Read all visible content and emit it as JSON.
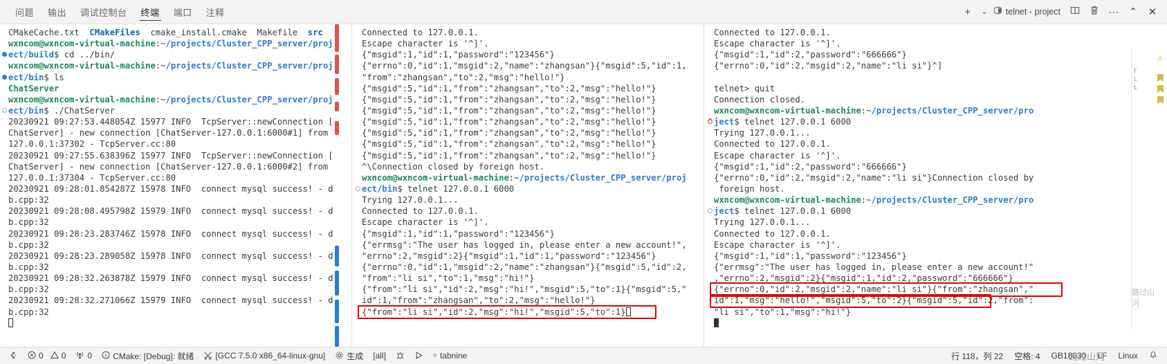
{
  "panel": {
    "tabs": [
      {
        "label": "问题",
        "active": false
      },
      {
        "label": "输出",
        "active": false
      },
      {
        "label": "调试控制台",
        "active": false
      },
      {
        "label": "终端",
        "active": true
      },
      {
        "label": "端口",
        "active": false
      },
      {
        "label": "注释",
        "active": false
      }
    ],
    "actions": {
      "add_label": "+",
      "add_dropdown": "⌄",
      "terminal_name": "telnet - project",
      "terminal_icon": "terminal-icon",
      "split_label": "▯▯",
      "kill_label": "🗑",
      "more_label": "···",
      "maximize_label": "⌃",
      "close_label": "✕"
    }
  },
  "terminal_1": {
    "lines": [
      {
        "deco": "",
        "segs": [
          {
            "t": "CMakeCache.txt  ",
            "c": "plain"
          },
          {
            "t": "CMakeFiles",
            "c": "blu"
          },
          {
            "t": "  cmake_install.cmake  Makefile  ",
            "c": "plain"
          },
          {
            "t": "src",
            "c": "blu"
          }
        ]
      },
      {
        "deco": "",
        "segs": [
          {
            "t": "wxncom@wxncom-virtual-machine",
            "c": "grn"
          },
          {
            "t": ":",
            "c": "plain"
          },
          {
            "t": "~/projects/Cluster_CPP_server/proj",
            "c": "blu-dir"
          }
        ]
      },
      {
        "deco": "filled",
        "segs": [
          {
            "t": "ect/build",
            "c": "blu-dir"
          },
          {
            "t": "$ cd ../bin/",
            "c": "plain"
          }
        ]
      },
      {
        "deco": "",
        "segs": [
          {
            "t": "wxncom@wxncom-virtual-machine",
            "c": "grn"
          },
          {
            "t": ":",
            "c": "plain"
          },
          {
            "t": "~/projects/Cluster_CPP_server/proj",
            "c": "blu-dir"
          }
        ]
      },
      {
        "deco": "filled",
        "segs": [
          {
            "t": "ect/bin",
            "c": "blu-dir"
          },
          {
            "t": "$ ls",
            "c": "plain"
          }
        ]
      },
      {
        "deco": "",
        "segs": [
          {
            "t": "ChatServer",
            "c": "grn"
          }
        ]
      },
      {
        "deco": "",
        "segs": [
          {
            "t": "wxncom@wxncom-virtual-machine",
            "c": "grn"
          },
          {
            "t": ":",
            "c": "plain"
          },
          {
            "t": "~/projects/Cluster_CPP_server/proj",
            "c": "blu-dir"
          }
        ]
      },
      {
        "deco": "hollow",
        "segs": [
          {
            "t": "ect/bin",
            "c": "blu-dir"
          },
          {
            "t": "$ ./ChatServer",
            "c": "plain"
          }
        ]
      },
      {
        "deco": "",
        "segs": [
          {
            "t": "20230921 09:27:53.448054Z 15977 INFO  TcpServer::newConnection [",
            "c": "plain"
          }
        ]
      },
      {
        "deco": "",
        "segs": [
          {
            "t": "ChatServer] - new connection [ChatServer-127.0.0.1:6000#1] from",
            "c": "plain"
          }
        ]
      },
      {
        "deco": "",
        "segs": [
          {
            "t": "127.0.0.1:37302 - TcpServer.cc:80",
            "c": "plain"
          }
        ]
      },
      {
        "deco": "",
        "segs": [
          {
            "t": "20230921 09:27:55.638396Z 15977 INFO  TcpServer::newConnection [",
            "c": "plain"
          }
        ]
      },
      {
        "deco": "",
        "segs": [
          {
            "t": "ChatServer] - new connection [ChatServer-127.0.0.1:6000#2] from",
            "c": "plain"
          }
        ]
      },
      {
        "deco": "",
        "segs": [
          {
            "t": "127.0.0.1:37304 - TcpServer.cc:80",
            "c": "plain"
          }
        ]
      },
      {
        "deco": "",
        "segs": [
          {
            "t": "20230921 09:28:01.854287Z 15978 INFO  connect mysql success! - d",
            "c": "plain"
          }
        ]
      },
      {
        "deco": "",
        "segs": [
          {
            "t": "b.cpp:32",
            "c": "plain"
          }
        ]
      },
      {
        "deco": "",
        "segs": [
          {
            "t": "20230921 09:28:08.495798Z 15979 INFO  connect mysql success! - d",
            "c": "plain"
          }
        ]
      },
      {
        "deco": "",
        "segs": [
          {
            "t": "b.cpp:32",
            "c": "plain"
          }
        ]
      },
      {
        "deco": "",
        "segs": [
          {
            "t": "20230921 09:28:23.283746Z 15978 INFO  connect mysql success! - d",
            "c": "plain"
          }
        ]
      },
      {
        "deco": "",
        "segs": [
          {
            "t": "b.cpp:32",
            "c": "plain"
          }
        ]
      },
      {
        "deco": "",
        "segs": [
          {
            "t": "20230921 09:28:23.289058Z 15978 INFO  connect mysql success! - d",
            "c": "plain"
          }
        ]
      },
      {
        "deco": "",
        "segs": [
          {
            "t": "b.cpp:32",
            "c": "plain"
          }
        ]
      },
      {
        "deco": "",
        "segs": [
          {
            "t": "20230921 09:28:32.263878Z 15979 INFO  connect mysql success! - d",
            "c": "plain"
          }
        ]
      },
      {
        "deco": "",
        "segs": [
          {
            "t": "b.cpp:32",
            "c": "plain"
          }
        ]
      },
      {
        "deco": "",
        "segs": [
          {
            "t": "20230921 09:28:32.271066Z 15979 INFO  connect mysql success! - d",
            "c": "plain"
          }
        ]
      },
      {
        "deco": "",
        "segs": [
          {
            "t": "b.cpp:32",
            "c": "plain"
          }
        ]
      },
      {
        "deco": "",
        "segs": [
          {
            "t": "",
            "c": "plain"
          }
        ],
        "cursor": "hollow"
      }
    ]
  },
  "terminal_2": {
    "lines": [
      {
        "deco": "",
        "segs": [
          {
            "t": "Connected to 127.0.0.1.",
            "c": "plain"
          }
        ]
      },
      {
        "deco": "",
        "segs": [
          {
            "t": "Escape character is '^]'.",
            "c": "plain"
          }
        ]
      },
      {
        "deco": "",
        "segs": [
          {
            "t": "{\"msgid\":1,\"id\":1,\"password\":\"123456\"}",
            "c": "plain"
          }
        ]
      },
      {
        "deco": "",
        "segs": [
          {
            "t": "{\"errno\":0,\"id\":1,\"msgid\":2,\"name\":\"zhangsan\"}{\"msgid\":5,\"id\":1,",
            "c": "plain"
          }
        ]
      },
      {
        "deco": "",
        "segs": [
          {
            "t": "\"from\":\"zhangsan\",\"to\":2,\"msg\":\"hello!\"}",
            "c": "plain"
          }
        ]
      },
      {
        "deco": "",
        "segs": [
          {
            "t": "{\"msgid\":5,\"id\":1,\"from\":\"zhangsan\",\"to\":2,\"msg\":\"hello!\"}",
            "c": "plain"
          }
        ]
      },
      {
        "deco": "",
        "segs": [
          {
            "t": "{\"msgid\":5,\"id\":1,\"from\":\"zhangsan\",\"to\":2,\"msg\":\"hello!\"}",
            "c": "plain"
          }
        ]
      },
      {
        "deco": "",
        "segs": [
          {
            "t": "{\"msgid\":5,\"id\":1,\"from\":\"zhangsan\",\"to\":2,\"msg\":\"hello!\"}",
            "c": "plain"
          }
        ]
      },
      {
        "deco": "",
        "segs": [
          {
            "t": "{\"msgid\":5,\"id\":1,\"from\":\"zhangsan\",\"to\":2,\"msg\":\"hello!\"}",
            "c": "plain"
          }
        ]
      },
      {
        "deco": "",
        "segs": [
          {
            "t": "{\"msgid\":5,\"id\":1,\"from\":\"zhangsan\",\"to\":2,\"msg\":\"hello!\"}",
            "c": "plain"
          }
        ]
      },
      {
        "deco": "",
        "segs": [
          {
            "t": "{\"msgid\":5,\"id\":1,\"from\":\"zhangsan\",\"to\":2,\"msg\":\"hello!\"}",
            "c": "plain"
          }
        ]
      },
      {
        "deco": "",
        "segs": [
          {
            "t": "{\"msgid\":5,\"id\":1,\"from\":\"zhangsan\",\"to\":2,\"msg\":\"hello!\"}",
            "c": "plain"
          }
        ]
      },
      {
        "deco": "",
        "segs": [
          {
            "t": "^\\Connection closed by foreign host.",
            "c": "plain"
          }
        ]
      },
      {
        "deco": "",
        "segs": [
          {
            "t": "wxncom@wxncom-virtual-machine",
            "c": "grn"
          },
          {
            "t": ":",
            "c": "plain"
          },
          {
            "t": "~/projects/Cluster_CPP_server/proj",
            "c": "blu-dir"
          }
        ]
      },
      {
        "deco": "hollow",
        "segs": [
          {
            "t": "ect/bin",
            "c": "blu-dir"
          },
          {
            "t": "$ telnet 127.0.0.1 6000",
            "c": "plain"
          }
        ]
      },
      {
        "deco": "",
        "segs": [
          {
            "t": "Trying 127.0.0.1...",
            "c": "plain"
          }
        ]
      },
      {
        "deco": "",
        "segs": [
          {
            "t": "Connected to 127.0.0.1.",
            "c": "plain"
          }
        ]
      },
      {
        "deco": "",
        "segs": [
          {
            "t": "Escape character is '^]'.",
            "c": "plain"
          }
        ]
      },
      {
        "deco": "",
        "segs": [
          {
            "t": "{\"msgid\":1,\"id\":1,\"password\":\"123456\"}",
            "c": "plain"
          }
        ]
      },
      {
        "deco": "",
        "segs": [
          {
            "t": "{\"errmsg\":\"The user has logged in, please enter a new account!\",",
            "c": "plain"
          }
        ]
      },
      {
        "deco": "",
        "segs": [
          {
            "t": "\"errno\":2,\"msgid\":2}{\"msgid\":1,\"id\":1,\"password\":\"123456\"}",
            "c": "plain"
          }
        ]
      },
      {
        "deco": "",
        "segs": [
          {
            "t": "{\"errno\":0,\"id\":1,\"msgid\":2,\"name\":\"zhangsan\"}{\"msgid\":5,\"id\":2,",
            "c": "plain"
          }
        ]
      },
      {
        "deco": "",
        "segs": [
          {
            "t": "\"from\":\"li si\",\"to\":1,\"msg\":\"hi!\"}",
            "c": "plain"
          }
        ]
      },
      {
        "deco": "",
        "segs": [
          {
            "t": "{\"from\":\"li si\",\"id\":2,\"msg\":\"hi!\",\"msgid\":5,\"to\":1}{\"msgid\":5,\"",
            "c": "plain"
          }
        ]
      },
      {
        "deco": "",
        "segs": [
          {
            "t": "id\":1,\"from\":\"zhangsan\",\"to\":2,\"msg\":\"hello!\"}",
            "c": "plain"
          }
        ]
      },
      {
        "deco": "",
        "segs": [
          {
            "t": "{\"from\":\"li si\",\"id\":2,\"msg\":\"hi!\",\"msgid\":5,\"to\":1}",
            "c": "plain"
          }
        ],
        "cursor": "hollow",
        "boxed": true
      }
    ]
  },
  "terminal_3": {
    "lines": [
      {
        "deco": "",
        "segs": [
          {
            "t": "Connected to 127.0.0.1.",
            "c": "plain"
          }
        ]
      },
      {
        "deco": "",
        "segs": [
          {
            "t": "Escape character is '^]'.",
            "c": "plain"
          }
        ]
      },
      {
        "deco": "",
        "segs": [
          {
            "t": "{\"msgid\":1,\"id\":2,\"password\":\"666666\"}",
            "c": "plain"
          }
        ]
      },
      {
        "deco": "",
        "segs": [
          {
            "t": "{\"errno\":0,\"id\":2,\"msgid\":2,\"name\":\"li si\"}^]",
            "c": "plain"
          }
        ]
      },
      {
        "deco": "",
        "segs": [
          {
            "t": "",
            "c": "plain"
          }
        ]
      },
      {
        "deco": "",
        "segs": [
          {
            "t": "telnet> quit",
            "c": "plain"
          }
        ]
      },
      {
        "deco": "",
        "segs": [
          {
            "t": "Connection closed.",
            "c": "plain"
          }
        ]
      },
      {
        "deco": "",
        "segs": [
          {
            "t": "wxncom@wxncom-virtual-machine",
            "c": "grn"
          },
          {
            "t": ":",
            "c": "plain"
          },
          {
            "t": "~/projects/Cluster_CPP_server/pro",
            "c": "blu-dir"
          }
        ]
      },
      {
        "deco": "err",
        "segs": [
          {
            "t": "ject",
            "c": "blu-dir"
          },
          {
            "t": "$ telnet 127.0.0.1 6000",
            "c": "plain"
          }
        ]
      },
      {
        "deco": "",
        "segs": [
          {
            "t": "Trying 127.0.0.1...",
            "c": "plain"
          }
        ]
      },
      {
        "deco": "",
        "segs": [
          {
            "t": "Connected to 127.0.0.1.",
            "c": "plain"
          }
        ]
      },
      {
        "deco": "",
        "segs": [
          {
            "t": "Escape character is '^]'.",
            "c": "plain"
          }
        ]
      },
      {
        "deco": "",
        "segs": [
          {
            "t": "{\"msgid\":1,\"id\":2,\"password\":\"666666\"}",
            "c": "plain"
          }
        ]
      },
      {
        "deco": "",
        "segs": [
          {
            "t": "{\"errno\":0,\"id\":2,\"msgid\":2,\"name\":\"li si\"}Connection closed by",
            "c": "plain"
          }
        ]
      },
      {
        "deco": "",
        "segs": [
          {
            "t": " foreign host.",
            "c": "plain"
          }
        ]
      },
      {
        "deco": "",
        "segs": [
          {
            "t": "wxncom@wxncom-virtual-machine",
            "c": "grn"
          },
          {
            "t": ":",
            "c": "plain"
          },
          {
            "t": "~/projects/Cluster_CPP_server/pro",
            "c": "blu-dir"
          }
        ]
      },
      {
        "deco": "hollow",
        "segs": [
          {
            "t": "ject",
            "c": "blu-dir"
          },
          {
            "t": "$ telnet 127.0.0.1 6000",
            "c": "plain"
          }
        ]
      },
      {
        "deco": "",
        "segs": [
          {
            "t": "Trying 127.0.0.1...",
            "c": "plain"
          }
        ]
      },
      {
        "deco": "",
        "segs": [
          {
            "t": "Connected to 127.0.0.1.",
            "c": "plain"
          }
        ]
      },
      {
        "deco": "",
        "segs": [
          {
            "t": "Escape character is '^]'.",
            "c": "plain"
          }
        ]
      },
      {
        "deco": "",
        "segs": [
          {
            "t": "{\"msgid\":1,\"id\":1,\"password\":\"123456\"}",
            "c": "plain"
          }
        ]
      },
      {
        "deco": "",
        "segs": [
          {
            "t": "{\"errmsg\":\"The user has logged in, please enter a new account!\"",
            "c": "plain"
          }
        ]
      },
      {
        "deco": "",
        "segs": [
          {
            "t": ",\"errno\":2,\"msgid\":2}{\"msgid\":1,\"id\":2,\"password\":\"666666\"}",
            "c": "plain"
          }
        ]
      },
      {
        "deco": "",
        "segs": [
          {
            "t": "{\"errno\":0,\"id\":2,\"msgid\":2,\"name\":\"li si\"}{\"from\":\"zhangsan\",\"",
            "c": "plain"
          }
        ]
      },
      {
        "deco": "",
        "segs": [
          {
            "t": "id\":1,\"msg\":\"hello!\",\"msgid\":5,\"to\":2}{\"msgid\":5,\"id\":2,\"from\":",
            "c": "plain"
          }
        ]
      },
      {
        "deco": "",
        "segs": [
          {
            "t": "\"li si\",\"to\":1,\"msg\":\"hi!\"}",
            "c": "plain"
          }
        ]
      },
      {
        "deco": "",
        "segs": [
          {
            "t": "",
            "c": "plain"
          }
        ],
        "cursor": "solid"
      }
    ]
  },
  "statusbar": {
    "left": [
      {
        "icon": "remote-icon",
        "glyph": "⧉",
        "label": ""
      },
      {
        "icon": "error-icon",
        "glyph": "ⓧ",
        "label": "0"
      },
      {
        "icon": "warning-icon",
        "glyph": "⚠",
        "label": "0"
      },
      {
        "icon": "radio-tower-icon",
        "glyph": "((·))",
        "label": "0"
      },
      {
        "icon": "info-icon",
        "glyph": "ⓘ",
        "label": "CMake: [Debug]: 就绪"
      },
      {
        "icon": "tools-icon",
        "glyph": "✂",
        "label": "[GCC 7.5.0 x86_64-linux-gnu]"
      },
      {
        "icon": "gear-icon",
        "glyph": "⚙",
        "label": "生成"
      },
      {
        "icon": "target-icon",
        "glyph": "",
        "label": "[all]"
      },
      {
        "icon": "debug-icon",
        "glyph": "⚲",
        "label": ""
      },
      {
        "icon": "play-icon",
        "glyph": "▷",
        "label": ""
      },
      {
        "icon": "tabnine-icon",
        "glyph": "c",
        "label": "tabnine"
      }
    ],
    "right": [
      {
        "icon": "",
        "label": "行 118，列 22"
      },
      {
        "icon": "",
        "label": "空格: 4"
      },
      {
        "icon": "",
        "label": "GB18030"
      },
      {
        "icon": "",
        "label": "LF"
      },
      {
        "icon": "",
        "label": "Linux"
      },
      {
        "icon": "bell-icon",
        "glyph": "🔔",
        "label": ""
      }
    ]
  },
  "right_strip": {
    "lines": [
      "Г",
      "L",
      "L",
      "",
      "",
      ""
    ],
    "warning_glyph": "⚠"
  },
  "watermarks": {
    "corner": "CSDN @路过山河",
    "bottom": "路过山河"
  }
}
